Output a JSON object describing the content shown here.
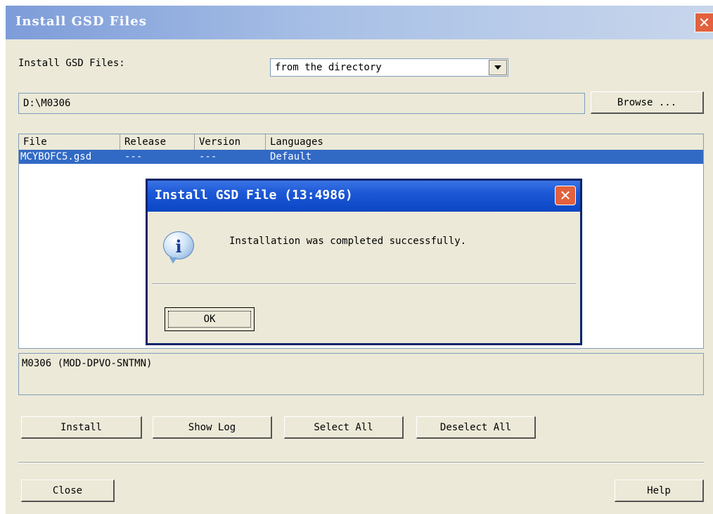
{
  "window": {
    "title": "Install GSD Files",
    "close_glyph": "✕"
  },
  "install_from": {
    "label": "Install GSD Files:",
    "selected": "from the directory"
  },
  "path": {
    "value": "D:\\M0306",
    "browse_label": "Browse ..."
  },
  "table": {
    "columns": [
      "File",
      "Release",
      "Version",
      "Languages"
    ],
    "rows": [
      {
        "file": "MCYBOFC5.gsd",
        "release": "---",
        "version": "---",
        "languages": "Default"
      }
    ]
  },
  "info_text": "M0306  (MOD-DPVO-SNTMN)",
  "buttons": {
    "install": "Install",
    "show_log": "Show Log",
    "select_all": "Select All",
    "deselect_all": "Deselect All",
    "close": "Close",
    "help": "Help"
  },
  "modal": {
    "title": "Install GSD File (13:4986)",
    "message": "Installation was completed successfully.",
    "ok_label": "OK",
    "icon_glyph": "i"
  }
}
